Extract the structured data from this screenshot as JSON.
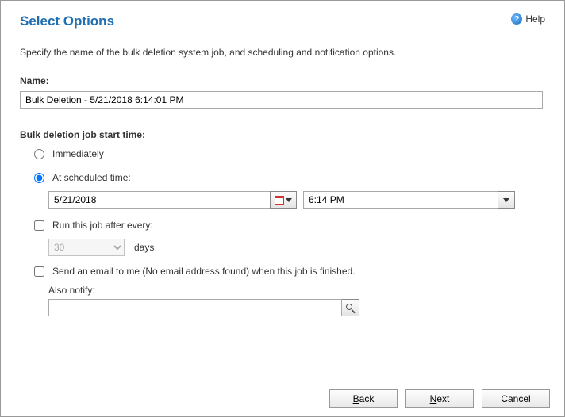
{
  "header": {
    "title": "Select Options",
    "help_label": "Help"
  },
  "intro": "Specify the name of the bulk deletion system job, and scheduling and notification options.",
  "name": {
    "label": "Name:",
    "value": "Bulk Deletion - 5/21/2018 6:14:01 PM"
  },
  "schedule": {
    "section_label": "Bulk deletion job start time:",
    "immediately_label": "Immediately",
    "scheduled_label": "At scheduled time:",
    "selected": "scheduled",
    "date_value": "5/21/2018",
    "time_value": "6:14 PM",
    "recur": {
      "label": "Run this job after every:",
      "checked": false,
      "value": "30",
      "suffix": "days"
    }
  },
  "notify": {
    "label": "Send an email to me (No email address found) when this job is finished.",
    "checked": false,
    "also_label": "Also notify:",
    "lookup_value": ""
  },
  "footer": {
    "back": "Back",
    "next": "Next",
    "cancel": "Cancel"
  }
}
